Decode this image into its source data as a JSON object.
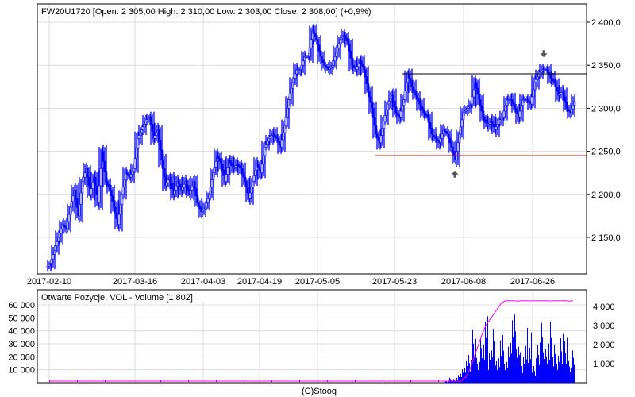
{
  "chart_data": [
    {
      "type": "ohlc",
      "title": "FW20U1720 [Open: 2 305,00  High: 2 310,00  Low: 2 303,00  Close: 2 308,00] (+0,9%)",
      "ylim": [
        2110,
        2420
      ],
      "y_ticks": [
        "2 150,0",
        "2 200,0",
        "2 250,0",
        "2 300,0",
        "2 350,0",
        "2 400,0"
      ],
      "y_tick_values": [
        2150,
        2200,
        2250,
        2300,
        2350,
        2400
      ],
      "x_ticks": [
        {
          "label": "2017-02-10",
          "index": 0
        },
        {
          "label": "2017-03-16",
          "index": 21.6
        },
        {
          "label": "2017-04-03",
          "index": 38.8
        },
        {
          "label": "2017-04-19",
          "index": 53
        },
        {
          "label": "2017-05-05",
          "index": 67.6
        },
        {
          "label": "2017-05-23",
          "index": 87
        },
        {
          "label": "2017-06-08",
          "index": 104.4
        },
        {
          "label": "2017-06-26",
          "index": 121.8
        }
      ],
      "close": [
        2120,
        2135,
        2150,
        2165,
        2160,
        2185,
        2205,
        2175,
        2215,
        2230,
        2200,
        2220,
        2190,
        2250,
        2215,
        2205,
        2185,
        2165,
        2200,
        2225,
        2220,
        2230,
        2265,
        2275,
        2285,
        2290,
        2265,
        2275,
        2240,
        2210,
        2220,
        2200,
        2215,
        2205,
        2215,
        2200,
        2215,
        2190,
        2180,
        2185,
        2200,
        2225,
        2245,
        2235,
        2215,
        2240,
        2230,
        2235,
        2230,
        2215,
        2195,
        2215,
        2235,
        2225,
        2255,
        2265,
        2270,
        2265,
        2255,
        2280,
        2310,
        2330,
        2345,
        2345,
        2360,
        2360,
        2390,
        2380,
        2360,
        2350,
        2345,
        2350,
        2365,
        2380,
        2385,
        2375,
        2350,
        2345,
        2355,
        2345,
        2320,
        2300,
        2270,
        2260,
        2285,
        2305,
        2315,
        2295,
        2290,
        2310,
        2340,
        2325,
        2315,
        2305,
        2295,
        2290,
        2270,
        2265,
        2260,
        2275,
        2270,
        2255,
        2240,
        2270,
        2295,
        2300,
        2305,
        2330,
        2310,
        2290,
        2280,
        2285,
        2275,
        2285,
        2290,
        2310,
        2310,
        2300,
        2290,
        2310,
        2310,
        2305,
        2330,
        2340,
        2345,
        2345,
        2335,
        2330,
        2315,
        2320,
        2300,
        2295,
        2308
      ],
      "lines": [
        {
          "name": "resistance",
          "value": 2340,
          "from_index": 89,
          "color": "#000000"
        },
        {
          "name": "support",
          "value": 2245,
          "from_index": 82,
          "color": "#ff0000"
        }
      ],
      "arrows": [
        {
          "direction": "down",
          "index": 124.6,
          "value": 2362
        },
        {
          "direction": "up",
          "index": 102.2,
          "value": 2225
        }
      ],
      "series_color": "#0000ff"
    },
    {
      "type": "bar+line",
      "title": "Otwarte Pozycje, VOL - Volume [1 802]",
      "left_ticks": [
        "10 000",
        "20 000",
        "30 000",
        "40 000",
        "50 000",
        "60 000"
      ],
      "left_tick_values": [
        10000,
        20000,
        30000,
        40000,
        50000,
        60000
      ],
      "right_ticks": [
        "1 000",
        "2 000",
        "3 000",
        "4 000"
      ],
      "right_tick_values": [
        1000,
        2000,
        3000,
        4000
      ],
      "volume_start_index": 100,
      "volume": [
        100,
        300,
        200,
        500,
        800,
        1200,
        2000,
        3500,
        1500,
        2500,
        4000,
        1800,
        3000,
        2200,
        3800,
        1500,
        2600,
        4100,
        2000,
        1700,
        3300,
        2800,
        1200,
        2500,
        3600,
        1900,
        4000,
        2300,
        1500,
        3200,
        2700,
        1300,
        1800
      ],
      "open_interest_start_index": 104,
      "open_interest": [
        150,
        300,
        700,
        1300,
        1900,
        2500,
        3000,
        3300,
        3600,
        3900,
        4200,
        4300,
        4300,
        4300,
        4280,
        4300,
        4300,
        4290,
        4300,
        4300,
        4300,
        4300,
        4290,
        4300,
        4300,
        4300,
        4300,
        4280,
        4300
      ],
      "volume_color": "#0000ff",
      "open_interest_color": "#ff00ff"
    }
  ],
  "footer": "(C)Stooq"
}
